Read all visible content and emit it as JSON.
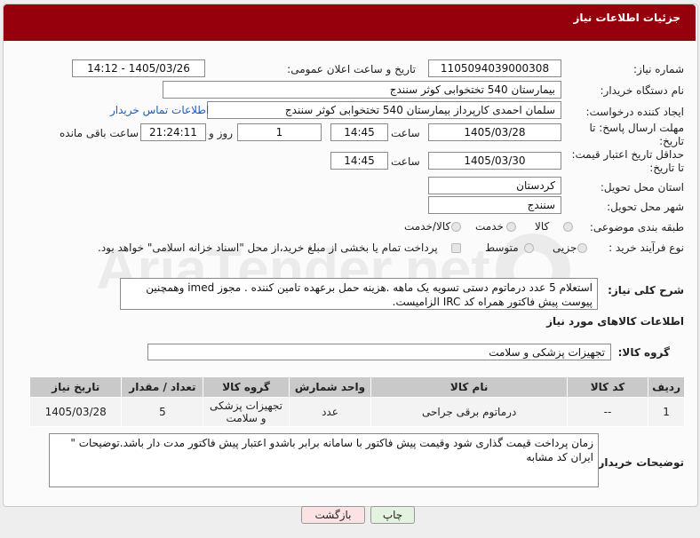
{
  "panel": {
    "title": "جزئیات اطلاعات نیاز"
  },
  "fields": {
    "need_number": {
      "label": "شماره نیاز:",
      "value": "1105094039000308"
    },
    "announce_datetime": {
      "label": "تاریخ و ساعت اعلان عمومی:",
      "value": "1405/03/26 - 14:12"
    },
    "buyer_org": {
      "label": "نام دستگاه خریدار:",
      "value": "بیمارستان 540 تختخوابی کوثر سنندج"
    },
    "requester": {
      "label": "ایجاد کننده درخواست:",
      "value": "سلمان احمدی کارپرداز بیمارستان 540 تختخوابی کوثر سنندج",
      "link": "اطلاعات تماس خریدار"
    },
    "reply_deadline": {
      "label_line1": "مهلت ارسال پاسخ: تا",
      "label_line2": "تاریخ:",
      "date": "1405/03/28",
      "time_label": "ساعت",
      "time": "14:45",
      "days": "1",
      "days_label": "روز و",
      "remaining": "21:24:11",
      "remaining_label": "ساعت باقی مانده"
    },
    "price_validity": {
      "label_line1": "حداقل تاریخ اعتبار قیمت:",
      "label_line2": "تا تاریخ:",
      "date": "1405/03/30",
      "time_label": "ساعت",
      "time": "14:45"
    },
    "delivery_province": {
      "label": "استان محل تحویل:",
      "value": "کردستان"
    },
    "delivery_city": {
      "label": "شهر محل تحویل:",
      "value": "سنندج"
    },
    "category": {
      "label": "طبقه بندی موضوعی:",
      "options": [
        "کالا",
        "خدمت",
        "کالا/خدمت"
      ],
      "value": "کالا/خدمت"
    },
    "purchase_type": {
      "label": "نوع فرآیند خرید :",
      "options": [
        "جزیی",
        "متوسط"
      ],
      "payment_note": "پرداخت تمام یا بخشی از مبلغ خرید،از محل \"اسناد خزانه اسلامی\" خواهد بود."
    }
  },
  "description": {
    "label": "شرح کلی نیاز:",
    "text": "استعلام 5 عدد درماتوم دستی   تسویه یک ماهه .هزینه حمل برعهده تامین کننده . مجوز imed وهمچنین پیوست پیش فاکتور همراه کد IRC  الزامیست."
  },
  "goods_section": {
    "title": "اطلاعات کالاهای مورد نیاز"
  },
  "goods_group": {
    "label": "گروه کالا:",
    "value": "تجهیزات پزشکی و سلامت"
  },
  "table": {
    "headers": [
      "ردیف",
      "کد کالا",
      "نام کالا",
      "واحد شمارش",
      "گروه کالا",
      "تعداد / مقدار",
      "تاریخ نیاز"
    ],
    "rows": [
      [
        "1",
        "--",
        "درماتوم برقی جراحی",
        "عدد",
        "تجهیزات پزشکی و سلامت",
        "5",
        "1405/03/28"
      ]
    ]
  },
  "buyer_notes": {
    "label": "توضیحات خریدار:",
    "text": "زمان پرداخت قیمت گذاری شود وقیمت پیش فاکتور با سامانه برابر باشدو اعتبار پیش فاکتور مدت دار باشد.توضیحات \" ایران کد مشابه"
  },
  "buttons": {
    "back": "بازگشت",
    "print": "چاپ"
  },
  "watermark": {
    "text": "AriaTender.net"
  },
  "colors": {
    "header": "#96000c",
    "back_button": "#fbe3e3",
    "print_button": "#e3f3e0",
    "link": "#1f5bb5"
  }
}
